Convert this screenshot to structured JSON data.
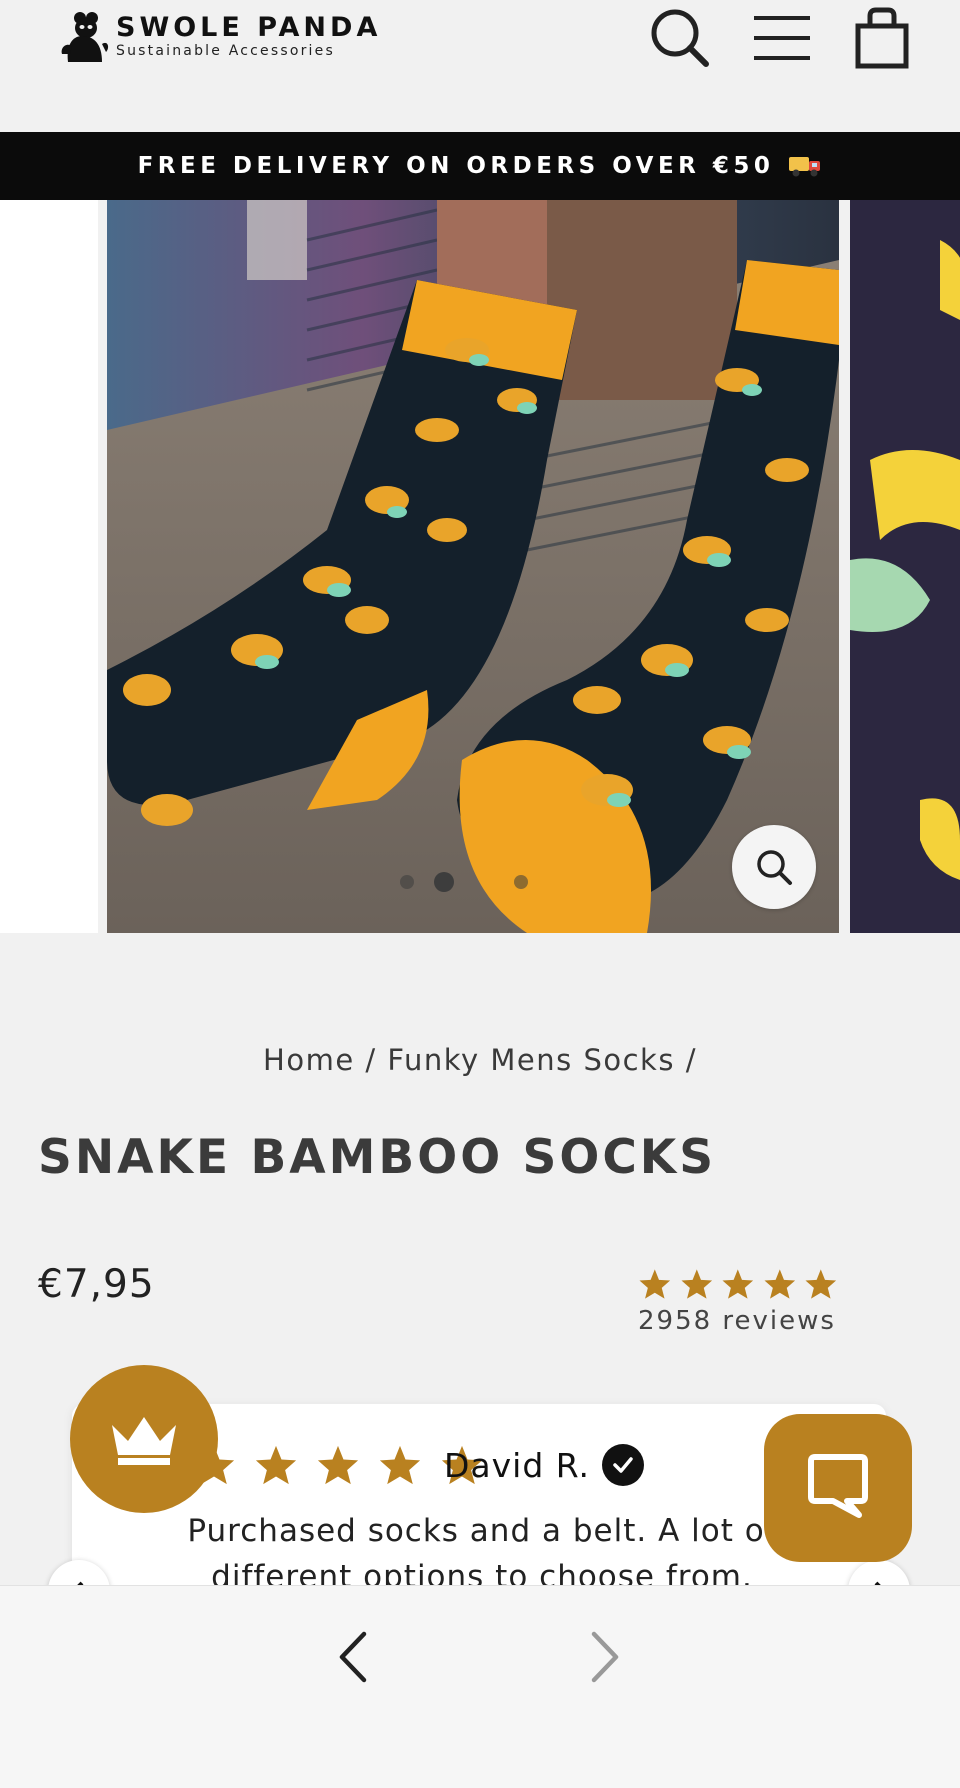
{
  "header": {
    "brand": "SWOLE PANDA",
    "tagline": "Sustainable Accessories",
    "icons": [
      "search-icon",
      "menu-icon",
      "cart-icon"
    ]
  },
  "announcement": {
    "text": "FREE DELIVERY ON ORDERS OVER €50",
    "icon": "delivery-truck-icon"
  },
  "gallery": {
    "slide_count": 3,
    "active_slide": 1,
    "zoom_icon": "zoom-icon"
  },
  "breadcrumb": {
    "home": "Home",
    "separator": "/",
    "category": "Funky Mens Socks"
  },
  "product": {
    "title": "SNAKE BAMBOO SOCKS",
    "price": "€7,95",
    "rating_stars": 5,
    "reviews": "2958 reviews"
  },
  "review": {
    "stars": 5,
    "reviewer": "David R.",
    "text": "Purchased socks and a belt. A lot of different options to choose from."
  },
  "widgets": {
    "rewards_icon": "crown-icon",
    "chat_icon": "chat-bubble-icon"
  },
  "colors": {
    "accent": "#b98120",
    "announcement_bg": "#0b0b0b",
    "star": "#b98120",
    "page_bg": "#f1f1f1"
  }
}
